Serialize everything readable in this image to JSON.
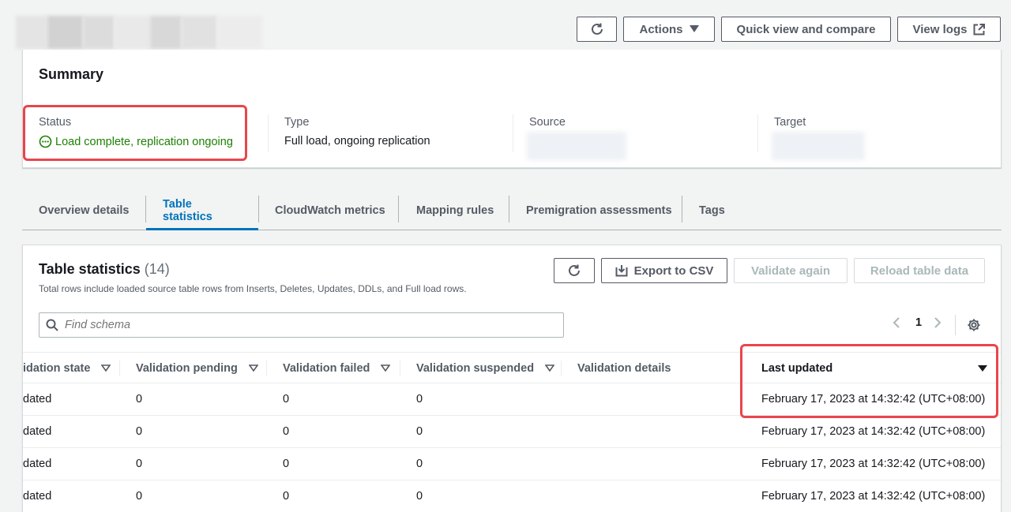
{
  "header": {
    "actions_label": "Actions",
    "quick_view_label": "Quick view and compare",
    "view_logs_label": "View logs"
  },
  "summary": {
    "title": "Summary",
    "status_label": "Status",
    "status_value": "Load complete, replication ongoing",
    "type_label": "Type",
    "type_value": "Full load, ongoing replication",
    "source_label": "Source",
    "target_label": "Target"
  },
  "tabs": [
    {
      "label": "Overview details"
    },
    {
      "label": "Table statistics"
    },
    {
      "label": "CloudWatch metrics"
    },
    {
      "label": "Mapping rules"
    },
    {
      "label": "Premigration assessments"
    },
    {
      "label": "Tags"
    }
  ],
  "table_stats": {
    "title": "Table statistics",
    "count": "(14)",
    "description": "Total rows include loaded source table rows from Inserts, Deletes, Updates, DDLs, and Full load rows.",
    "export_label": "Export to CSV",
    "validate_label": "Validate again",
    "reload_label": "Reload table data",
    "search_placeholder": "Find schema",
    "page": "1",
    "columns": [
      "idation state",
      "Validation pending",
      "Validation failed",
      "Validation suspended",
      "Validation details",
      "Last updated"
    ],
    "rows": [
      [
        "dated",
        "0",
        "0",
        "0",
        "",
        "February 17, 2023 at 14:32:42 (UTC+08:00)"
      ],
      [
        "dated",
        "0",
        "0",
        "0",
        "",
        "February 17, 2023 at 14:32:42 (UTC+08:00)"
      ],
      [
        "dated",
        "0",
        "0",
        "0",
        "",
        "February 17, 2023 at 14:32:42 (UTC+08:00)"
      ],
      [
        "dated",
        "0",
        "0",
        "0",
        "",
        "February 17, 2023 at 14:32:42 (UTC+08:00)"
      ]
    ]
  },
  "colors": {
    "accent": "#0073bb",
    "success": "#1d8102",
    "highlight": "#e9454c"
  }
}
